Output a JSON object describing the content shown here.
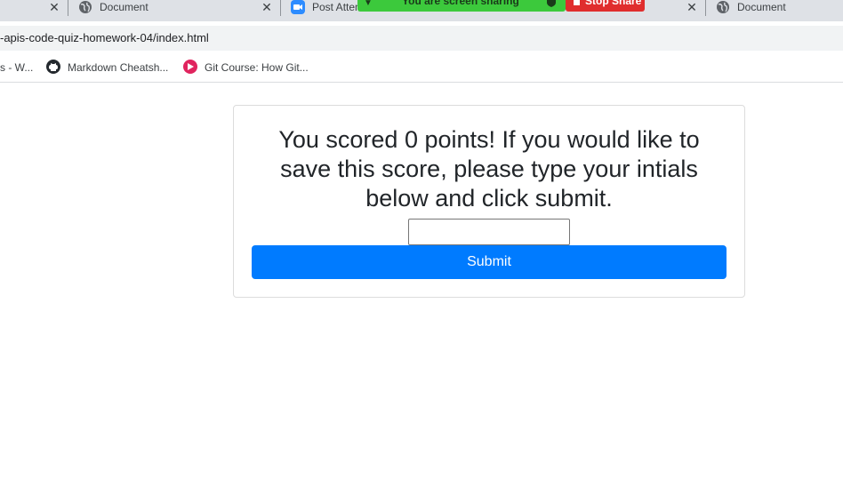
{
  "browser": {
    "tabs": [
      {
        "label": "Document",
        "icon": "globe-icon"
      },
      {
        "label": "Post Atten",
        "icon": "zoom-icon"
      },
      {
        "label": "Document",
        "icon": "globe-icon"
      }
    ],
    "close_glyph": "✕",
    "url": "-apis-code-quiz-homework-04/index.html",
    "bookmarks": [
      {
        "label": "s - W..."
      },
      {
        "label": "Markdown Cheatsh...",
        "icon": "github-icon"
      },
      {
        "label": "Git Course: How Git...",
        "icon": "course-icon"
      }
    ]
  },
  "screen_share": {
    "status_text": "You are screen sharing",
    "stop_label": "Stop Share",
    "bar_color": "#3cc93c",
    "stop_color": "#e02d2d"
  },
  "quiz": {
    "score_message": "You scored 0 points! If you would like to save this score, please type your intials below and click submit.",
    "initials_value": "",
    "submit_label": "Submit",
    "button_color": "#007bff"
  }
}
